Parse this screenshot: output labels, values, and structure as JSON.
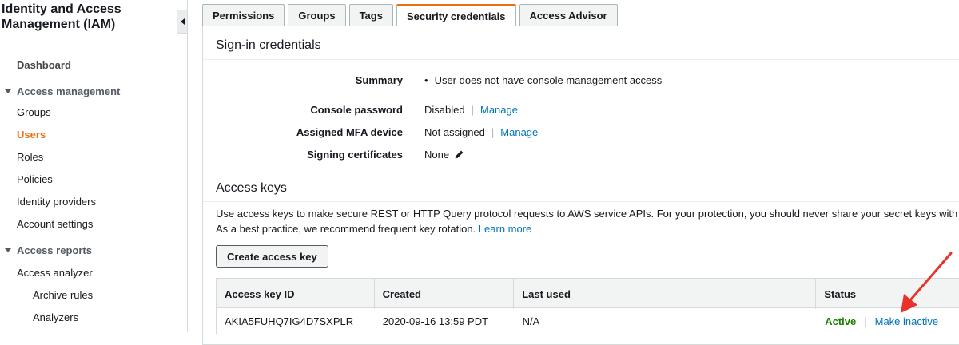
{
  "sidebar": {
    "title": "Identity and Access Management (IAM)",
    "dashboard": "Dashboard",
    "sections": [
      {
        "label": "Access management",
        "items": [
          "Groups",
          "Users",
          "Roles",
          "Policies",
          "Identity providers",
          "Account settings"
        ],
        "active": "Users"
      },
      {
        "label": "Access reports",
        "items": [
          "Access analyzer",
          "Archive rules",
          "Analyzers"
        ]
      }
    ]
  },
  "tabs": [
    "Permissions",
    "Groups",
    "Tags",
    "Security credentials",
    "Access Advisor"
  ],
  "active_tab": "Security credentials",
  "signin": {
    "title": "Sign-in credentials",
    "summary_label": "Summary",
    "summary_value": "User does not have console management access",
    "console_password_label": "Console password",
    "console_password_value": "Disabled",
    "console_password_link": "Manage",
    "mfa_label": "Assigned MFA device",
    "mfa_value": "Not assigned",
    "mfa_link": "Manage",
    "certs_label": "Signing certificates",
    "certs_value": "None"
  },
  "access_keys": {
    "title": "Access keys",
    "description_line1": "Use access keys to make secure REST or HTTP Query protocol requests to AWS service APIs. For your protection, you should never share your secret keys with anyo",
    "description_line2": "As a best practice, we recommend frequent key rotation.",
    "learn_more": "Learn more",
    "create_button": "Create access key",
    "columns": [
      "Access key ID",
      "Created",
      "Last used",
      "Status"
    ],
    "rows": [
      {
        "id": "AKIA5FUHQ7IG4D7SXPLR",
        "created": "2020-09-16 13:59 PDT",
        "last_used": "N/A",
        "status": "Active",
        "action": "Make inactive"
      }
    ]
  },
  "icons": {
    "collapse": "chevron-left-icon",
    "edit": "pencil-icon",
    "annotation": "red-arrow"
  },
  "colors": {
    "accent": "#ec7211",
    "link": "#0073bb",
    "active": "#1d8102",
    "annotation": "#e8322a"
  }
}
